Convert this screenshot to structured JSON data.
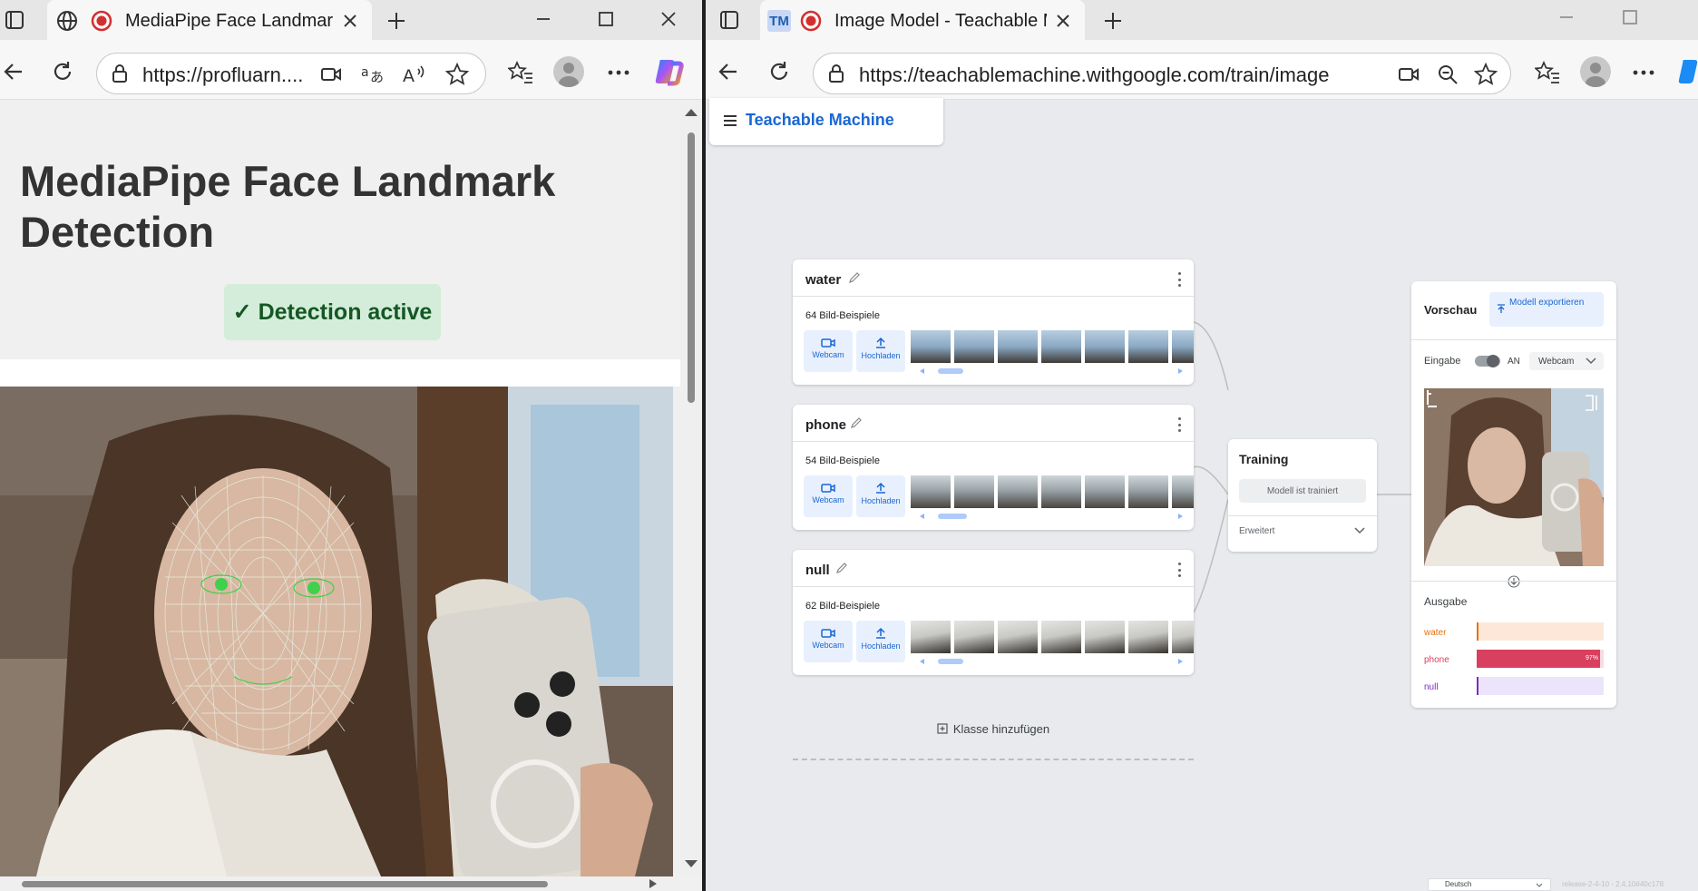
{
  "left_window": {
    "tab_title": "MediaPipe Face Landmark D",
    "url": "https://profluarn....",
    "page": {
      "title": "MediaPipe Face Landmark Detection",
      "status": "✓ Detection active"
    }
  },
  "right_window": {
    "tab_title": "Image Model - Teachable Ma",
    "tab_favicon_text": "TM",
    "url": "https://teachablemachine.withgoogle.com/train/image",
    "page": {
      "app_title": "Teachable Machine",
      "classes": [
        {
          "name": "water",
          "count": "64 Bild-Beispiele"
        },
        {
          "name": "phone",
          "count": "54 Bild-Beispiele"
        },
        {
          "name": "null",
          "count": "62 Bild-Beispiele"
        }
      ],
      "webcam_label": "Webcam",
      "upload_label": "Hochladen",
      "add_class": "Klasse hinzufügen",
      "training": {
        "title": "Training",
        "button": "Modell ist trainiert",
        "advanced": "Erweitert"
      },
      "preview": {
        "title": "Vorschau",
        "export_button": "Modell exportieren",
        "input_label": "Eingabe",
        "toggle_state": "AN",
        "source": "Webcam",
        "output_label": "Ausgabe",
        "outputs": [
          {
            "name": "water",
            "value": 0,
            "label": "",
            "color": "#e8710a",
            "bg": "#fde7d9"
          },
          {
            "name": "phone",
            "value": 0.97,
            "label": "97%",
            "color": "#d93f5e",
            "bg": "#f9dbe1"
          },
          {
            "name": "null",
            "value": 0,
            "label": "",
            "color": "#7b2cbf",
            "bg": "#ece4fb"
          }
        ]
      },
      "footer_language": "Deutsch",
      "footer_version": "release-2-4-10 - 2.4.10#40c178"
    }
  }
}
